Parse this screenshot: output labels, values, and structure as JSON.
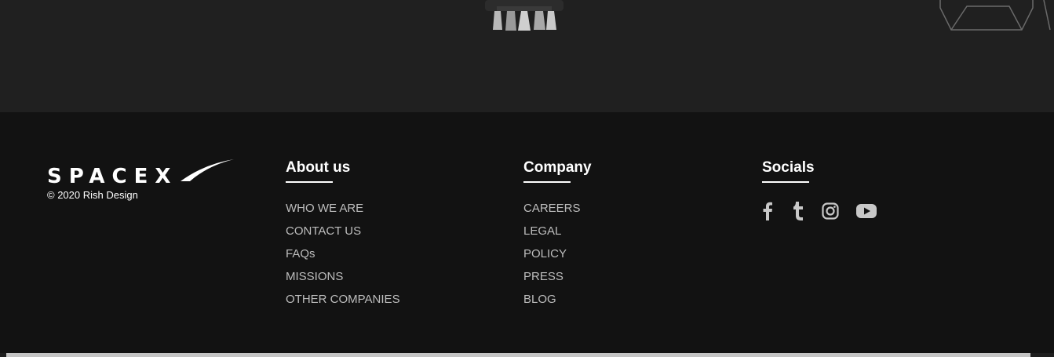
{
  "brand": {
    "logo_text": "SPACEX",
    "copyright": "© 2020 Rish Design"
  },
  "about": {
    "title": "About us",
    "links": [
      "WHO WE ARE",
      "CONTACT US",
      "FAQs",
      "MISSIONS",
      "OTHER COMPANIES"
    ]
  },
  "company": {
    "title": "Company",
    "links": [
      "CAREERS",
      "LEGAL",
      "POLICY",
      "PRESS",
      "BLOG"
    ]
  },
  "socials": {
    "title": "Socials",
    "icons": [
      "facebook-icon",
      "tumblr-icon",
      "instagram-icon",
      "youtube-icon"
    ]
  },
  "colors": {
    "hero_bg": "#202020",
    "footer_bg": "#121212",
    "link": "#bdbdbd",
    "heading": "#ffffff"
  }
}
